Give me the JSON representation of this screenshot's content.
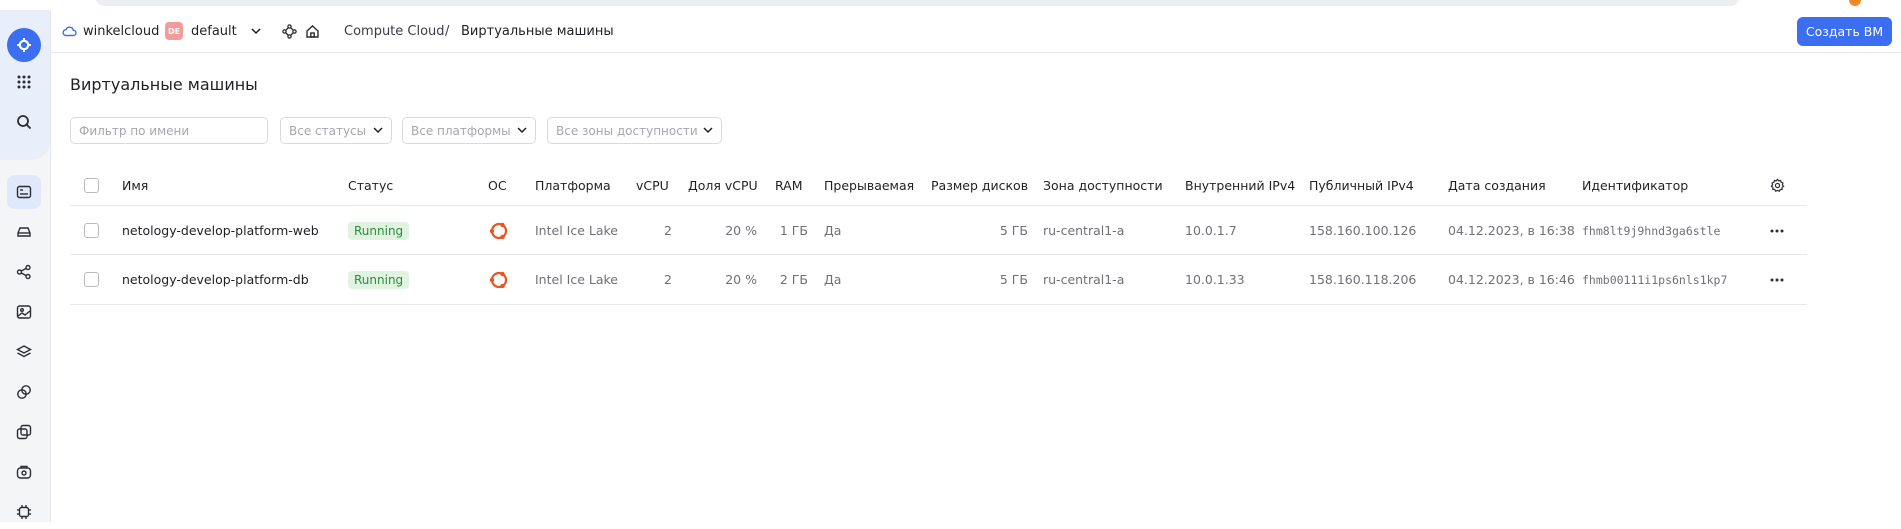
{
  "header": {
    "cloud_name": "winkelcloud",
    "folder_badge": "DE",
    "folder_name": "default",
    "breadcrumb_service": "Compute Cloud",
    "breadcrumb_sep": "/",
    "breadcrumb_current": "Виртуальные машины",
    "create_button": "Создать ВМ"
  },
  "page": {
    "title": "Виртуальные машины"
  },
  "filters": {
    "name_placeholder": "Фильтр по имени",
    "status": "Все статусы",
    "platform": "Все платформы",
    "zone": "Все зоны доступности"
  },
  "table": {
    "columns": {
      "name": "Имя",
      "status": "Статус",
      "os": "ОС",
      "platform": "Платформа",
      "vcpu": "vCPU",
      "vcpu_share": "Доля vCPU",
      "ram": "RAM",
      "preemptible": "Прерываемая",
      "disk_size": "Размер дисков",
      "zone": "Зона доступности",
      "internal_ip": "Внутренний IPv4",
      "public_ip": "Публичный IPv4",
      "created": "Дата создания",
      "id": "Идентификатор"
    },
    "rows": [
      {
        "name": "netology-develop-platform-web",
        "status": "Running",
        "os_icon": "ubuntu-icon",
        "platform": "Intel Ice Lake",
        "vcpu": "2",
        "vcpu_share": "20 %",
        "ram": "1 ГБ",
        "preemptible": "Да",
        "disk_size": "5 ГБ",
        "zone": "ru-central1-a",
        "internal_ip": "10.0.1.7",
        "public_ip": "158.160.100.126",
        "created": "04.12.2023, в 16:38",
        "id": "fhm8lt9j9hnd3ga6stle"
      },
      {
        "name": "netology-develop-platform-db",
        "status": "Running",
        "os_icon": "ubuntu-icon",
        "platform": "Intel Ice Lake",
        "vcpu": "2",
        "vcpu_share": "20 %",
        "ram": "2 ГБ",
        "preemptible": "Да",
        "disk_size": "5 ГБ",
        "zone": "ru-central1-a",
        "internal_ip": "10.0.1.33",
        "public_ip": "158.160.118.206",
        "created": "04.12.2023, в 16:46",
        "id": "fhmb00111i1ps6nls1kp7"
      }
    ]
  },
  "colors": {
    "accent": "#3b6ef0",
    "status_running_bg": "#dff3e0",
    "status_running_text": "#2e8b3a",
    "ubuntu": "#e95420"
  }
}
